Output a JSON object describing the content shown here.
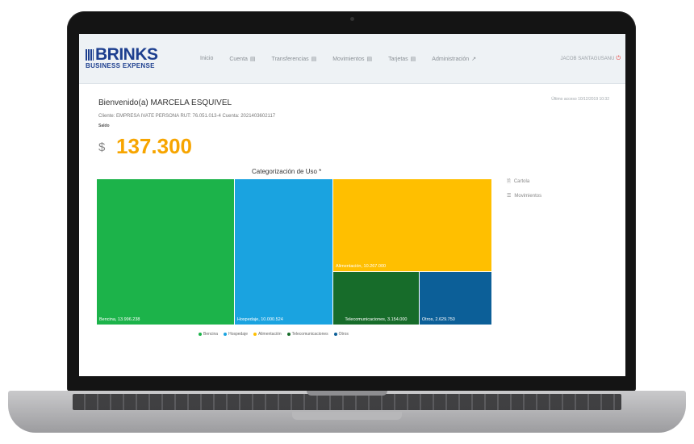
{
  "logo": {
    "main": "BRINKS",
    "sub": "BUSINESS EXPENSE"
  },
  "nav": [
    {
      "label": "Inicio",
      "icon": ""
    },
    {
      "label": "Cuenta",
      "icon": "▤"
    },
    {
      "label": "Transferencias",
      "icon": "▤"
    },
    {
      "label": "Movimientos",
      "icon": "▤"
    },
    {
      "label": "Tarjetas",
      "icon": "▤"
    },
    {
      "label": "Administración",
      "icon": "↗"
    }
  ],
  "user": {
    "name": "JACOB SANTAGUSANU",
    "logout_icon": "⏻"
  },
  "welcome": {
    "text": "Bienvenido(a) MARCELA ESQUIVEL",
    "last_login": "Último acceso 10/12/2019 10:32",
    "client_line": "Cliente: EMPRESA IVATE PERSONA  RUT: 76.051.013-4  Cuenta: 2021403602117",
    "saldo_label": "Saldo",
    "currency": "$",
    "amount": "137.300"
  },
  "chart_data": {
    "type": "treemap",
    "title": "Categorización de Uso *",
    "colors": {
      "Bencina": "#1cb34a",
      "Hospedaje": "#1aa3e0",
      "Alimentación": "#ffbf00",
      "Telecomunicaciones": "#176c2a",
      "Otros": "#0c5f98"
    },
    "items": [
      {
        "name": "Bencina",
        "value": 13996238,
        "label": "Bencina, 13.996.238"
      },
      {
        "name": "Hospedaje",
        "value": 10000524,
        "label": "Hospedaje, 10.000.524"
      },
      {
        "name": "Alimentación",
        "value": 10267000,
        "label": "Alimentación, 10.267.000"
      },
      {
        "name": "Telecomunicaciones",
        "value": 3154000,
        "label": "Telecomunicaciones, 3.154.000"
      },
      {
        "name": "Otros",
        "value": 2629750,
        "label": "Otros, 2.629.750"
      }
    ],
    "legend": [
      "Bencina",
      "Hospedaje",
      "Alimentación",
      "Telecomunicaciones",
      "Otros"
    ]
  },
  "side": [
    {
      "label": "Cartola",
      "icon": "🗎"
    },
    {
      "label": "Movimientos",
      "icon": "☰"
    }
  ]
}
